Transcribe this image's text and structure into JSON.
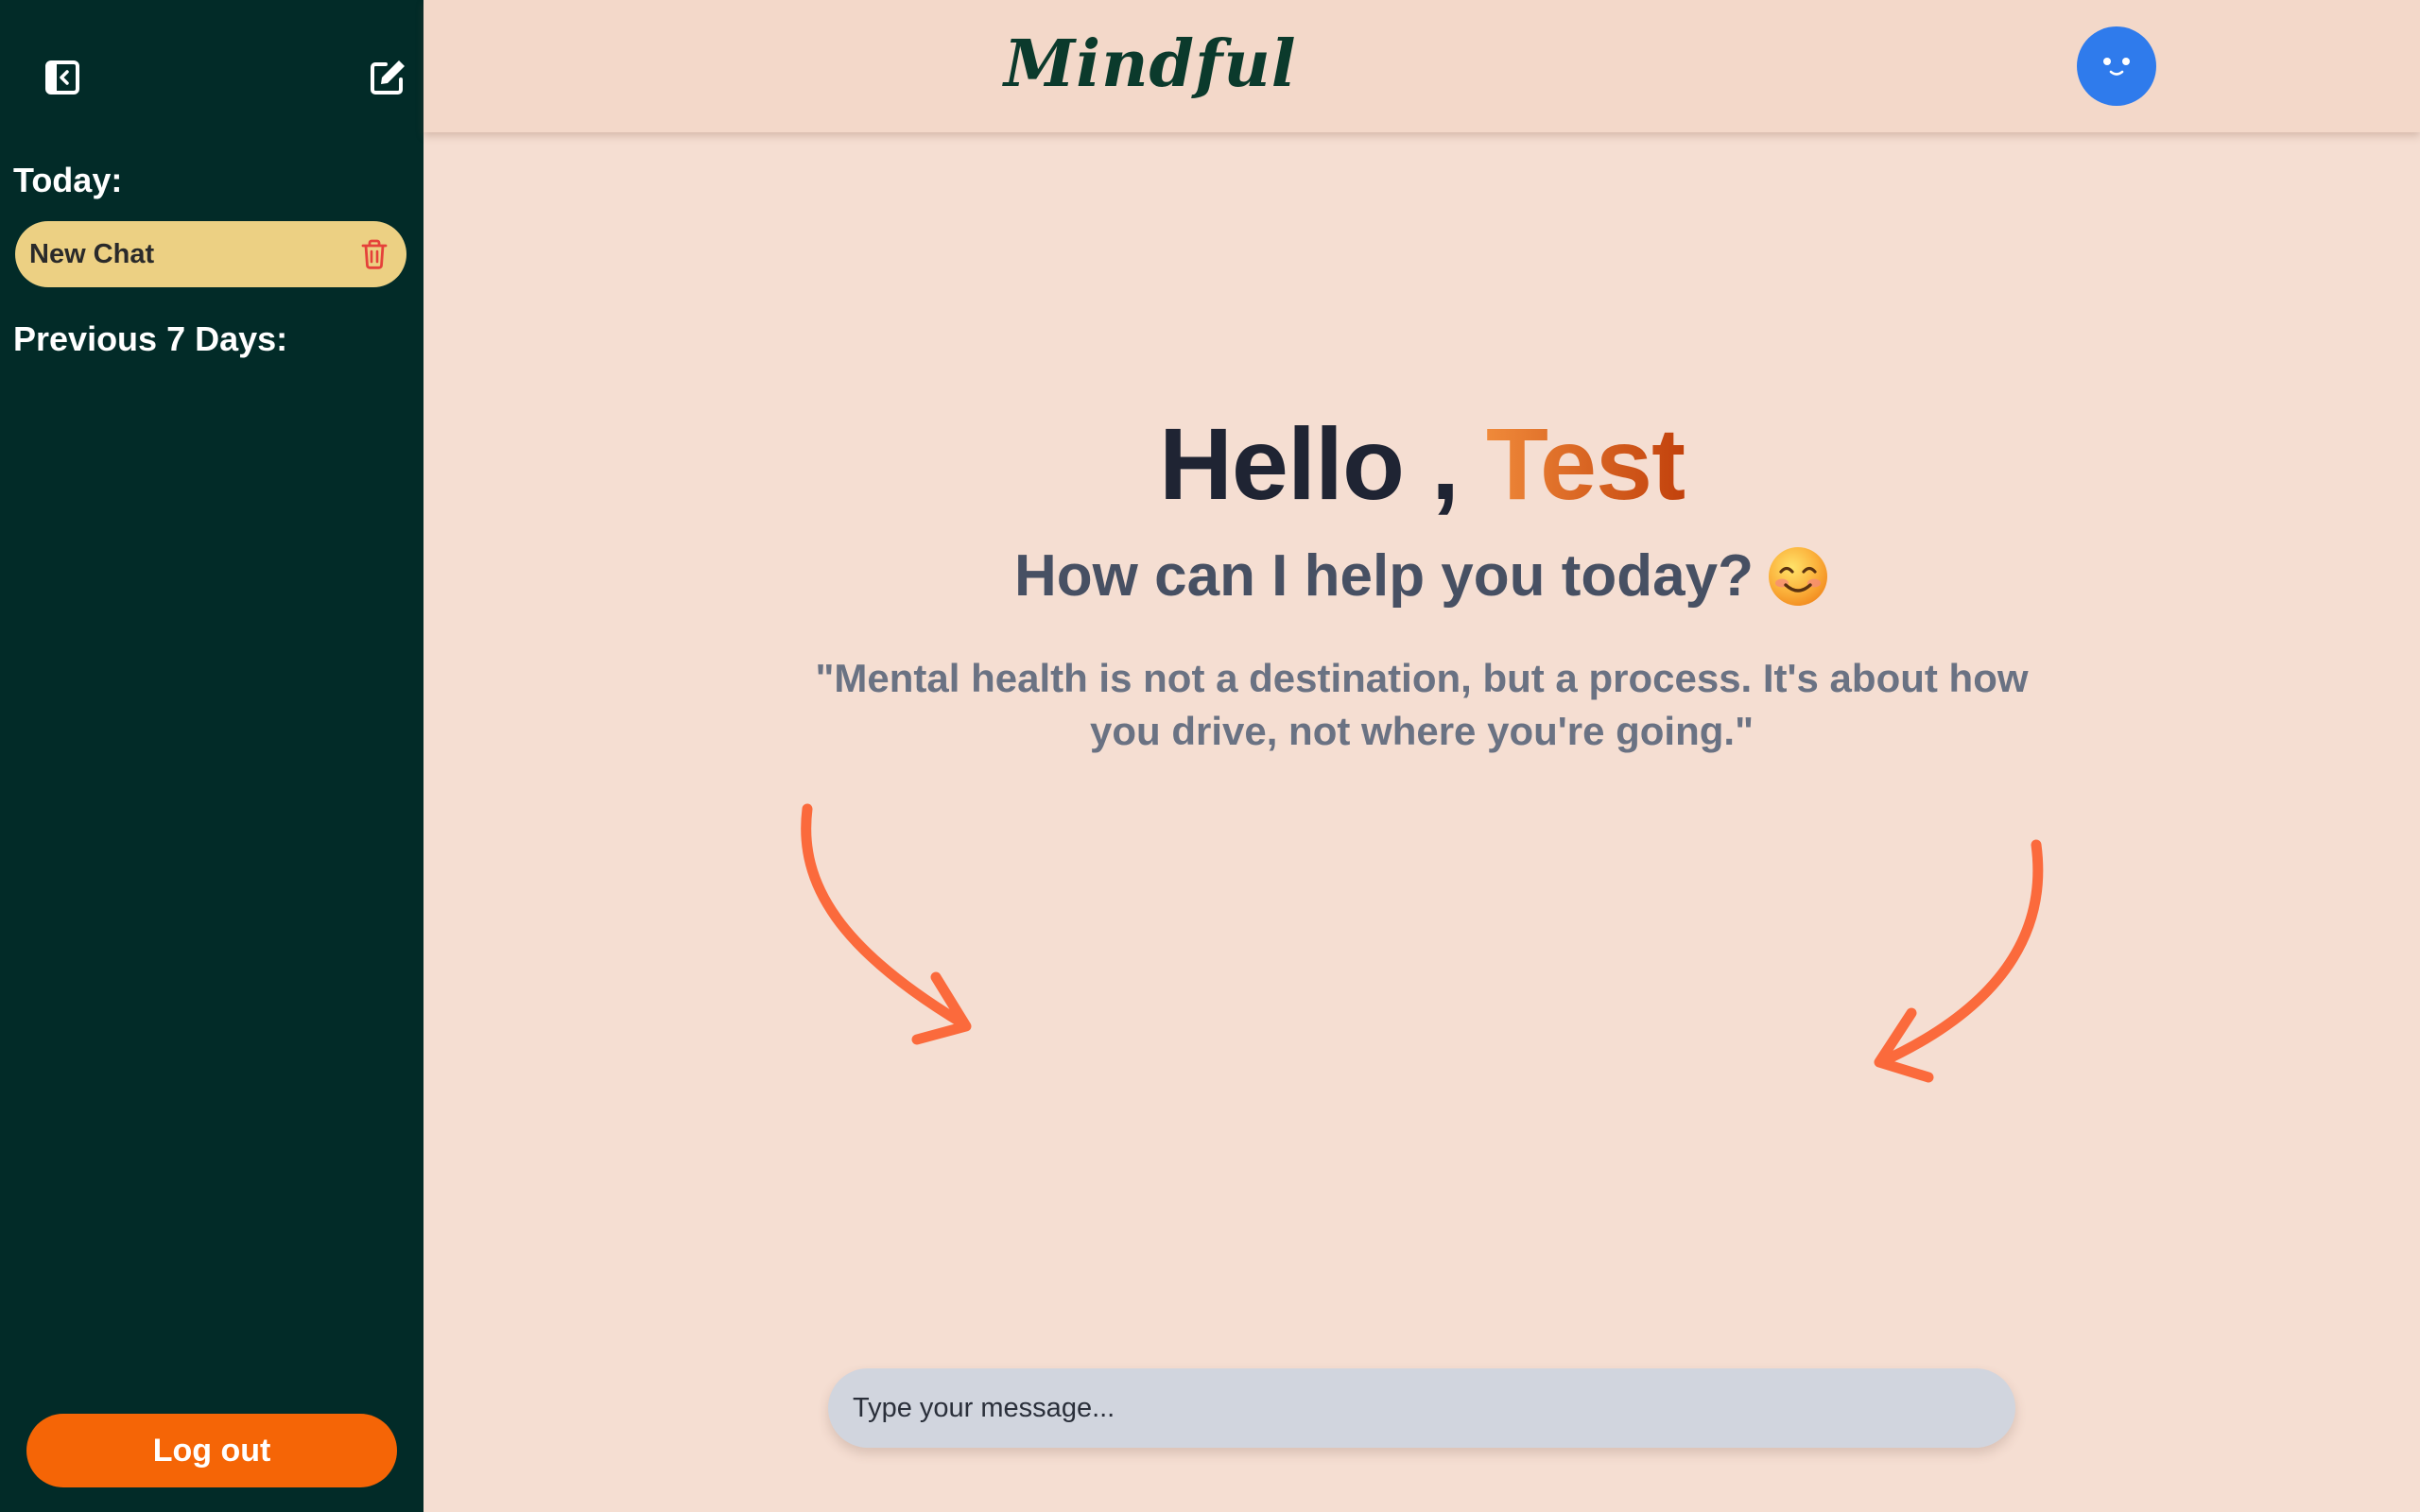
{
  "app": {
    "brand": "Mindful"
  },
  "sidebar": {
    "toggle_icon": "sidebar-collapse-icon",
    "compose_icon": "edit-icon",
    "sections": {
      "today_label": "Today:",
      "previous_label": "Previous 7 Days:"
    },
    "chats": [
      {
        "title": "New Chat",
        "delete_icon": "trash-icon"
      }
    ],
    "logout_label": "Log out"
  },
  "header": {
    "avatar_icon": "smiley-face-icon"
  },
  "main": {
    "greeting_prefix": "Hello , ",
    "greeting_name": "Test",
    "subtitle": "How can I help you today?",
    "subtitle_emoji": "smiling-face-emoji",
    "quote": "\"Mental health is not a destination, but a process. It's about how you drive, not where you're going.\"",
    "decor_icons": [
      "curved-arrow-icon",
      "curved-arrow-icon"
    ]
  },
  "composer": {
    "placeholder": "Type your message..."
  },
  "colors": {
    "sidebar_bg": "#022b28",
    "page_bg": "#f5ded2",
    "header_bg": "#f3d8c9",
    "chat_item_bg": "#ecd083",
    "logout_bg": "#f56506",
    "avatar_bg": "#2f7bec",
    "arrow": "#fb6a3c",
    "trash": "#e5413a"
  }
}
